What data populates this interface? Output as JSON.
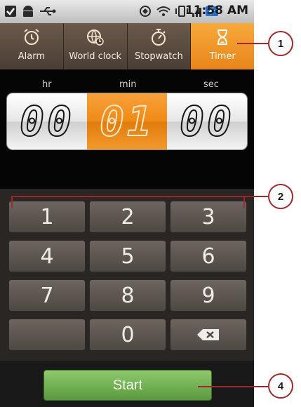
{
  "status_bar": {
    "time": "11:58 AM",
    "icons": [
      "check-icon",
      "android-icon",
      "usb-icon",
      "signal-strength-icon",
      "wifi-icon",
      "vibrate-icon",
      "cell-bars-icon",
      "battery-icon"
    ]
  },
  "tabs": [
    {
      "label": "Alarm",
      "icon": "alarm-clock-icon",
      "active": false
    },
    {
      "label": "World clock",
      "icon": "globe-clock-icon",
      "active": false
    },
    {
      "label": "Stopwatch",
      "icon": "stopwatch-icon",
      "active": false
    },
    {
      "label": "Timer",
      "icon": "hourglass-icon",
      "active": true
    }
  ],
  "timer": {
    "unit_labels": {
      "hours": "hr",
      "minutes": "min",
      "seconds": "sec"
    },
    "hours": "00",
    "minutes": "01",
    "seconds": "00"
  },
  "keypad": {
    "keys": [
      "1",
      "2",
      "3",
      "4",
      "5",
      "6",
      "7",
      "8",
      "9",
      "",
      "0",
      "backspace"
    ]
  },
  "footer": {
    "start_label": "Start"
  },
  "callouts": [
    "1",
    "2",
    "4"
  ],
  "colors": {
    "accent_orange": "#ef8a16",
    "start_green": "#6fae4d",
    "callout_red": "#a0282c"
  }
}
